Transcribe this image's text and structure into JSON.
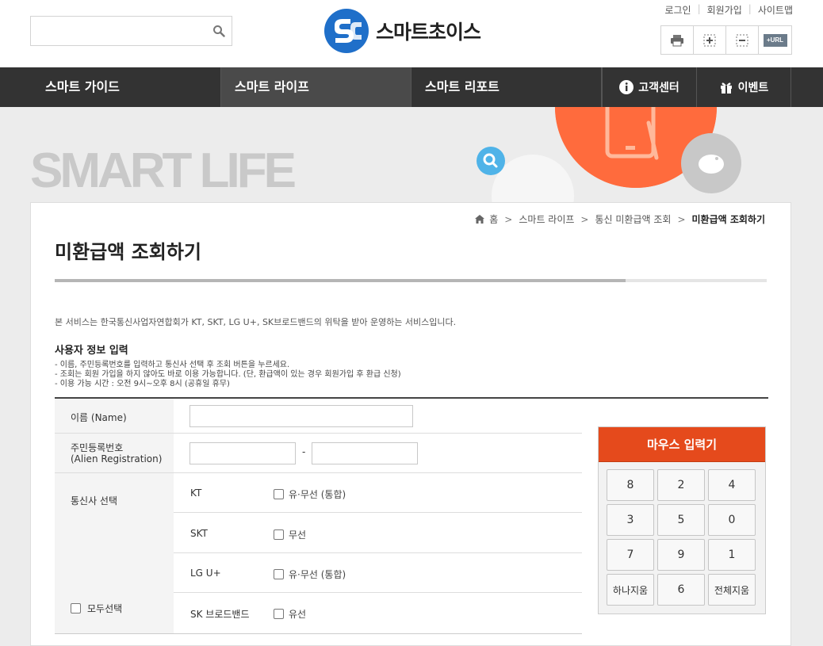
{
  "header": {
    "search_placeholder": "",
    "logo_text": "스마트초이스",
    "util_links": [
      "로그인",
      "회원가입",
      "사이트맵"
    ],
    "tools": [
      "print-icon",
      "zoom-in-icon",
      "zoom-out-icon",
      "url-copy-icon"
    ],
    "url_tool_label": "+URL"
  },
  "nav": {
    "items": [
      "스마트 가이드",
      "스마트 라이프",
      "스마트 리포트"
    ],
    "active_index": 1,
    "util": [
      "고객센터",
      "이벤트"
    ]
  },
  "hero": {
    "title": "SMART LIFE"
  },
  "breadcrumb": [
    "홈",
    "스마트 라이프",
    "통신 미환급액 조회",
    "미환급액 조회하기"
  ],
  "page": {
    "title": "미환급액 조회하기",
    "intro": "본 서비스는 한국통신사업자연합회가 KT, SKT, LG U+, SK브로드밴드의 위탁을 받아 운영하는 서비스입니다.",
    "section_title": "사용자 정보 입력",
    "notes": [
      "- 이름, 주민등록번호를 입력하고 통신사 선택 후 조회 버튼을 누르세요.",
      "- 조회는 회원 가입을 하지 않아도 바로 이용 가능합니다. (단, 환급액이 있는 경우 회원가입 후 환급 신청)",
      "- 이용 가능 시간 : 오전 9시~오후 8시 (공휴일 휴무)"
    ]
  },
  "form": {
    "name_label": "이름 (Name)",
    "name_value": "",
    "rrn_label_1": "주민등록번호",
    "rrn_label_2": "(Alien Registration)",
    "rrn_front": "",
    "rrn_sep": "-",
    "rrn_back": "",
    "carrier_label": "통신사 선택",
    "select_all_label": "모두선택",
    "carriers": [
      {
        "name": "KT",
        "option": "유·무선 (통합)"
      },
      {
        "name": "SKT",
        "option": "무선"
      },
      {
        "name": "LG U+",
        "option": "유·무선 (통합)"
      },
      {
        "name": "SK 브로드밴드",
        "option": "유선"
      }
    ]
  },
  "keypad": {
    "title": "마우스 입력기",
    "keys": [
      "8",
      "2",
      "4",
      "3",
      "5",
      "0",
      "7",
      "9",
      "1",
      "하나지움",
      "6",
      "전체지움"
    ]
  },
  "colors": {
    "nav_bg": "#333333",
    "accent_orange": "#e54a1c",
    "hero_circle": "#ff6b3d",
    "search_bubble": "#4fb3e8"
  }
}
